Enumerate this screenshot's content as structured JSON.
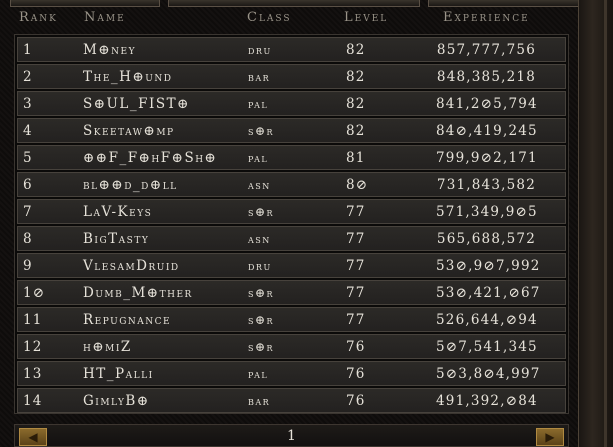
{
  "columns": {
    "rank": "Rank",
    "name": "Name",
    "class": "Class",
    "level": "Level",
    "experience": "Experience"
  },
  "rows": [
    {
      "rank": "1",
      "name": "M⊕ney",
      "class": "dru",
      "level": "82",
      "experience": "857,777,756"
    },
    {
      "rank": "2",
      "name": "The_H⊕und",
      "class": "bar",
      "level": "82",
      "experience": "848,385,218"
    },
    {
      "rank": "3",
      "name": "S⊕UL_FIST⊕",
      "class": "pal",
      "level": "82",
      "experience": "841,2⊘5,794"
    },
    {
      "rank": "4",
      "name": "Skeetaw⊕mp",
      "class": "s⊕r",
      "level": "82",
      "experience": "84⊘,419,245"
    },
    {
      "rank": "5",
      "name": "⊕⊕F_F⊕hF⊕Sh⊕",
      "class": "pal",
      "level": "81",
      "experience": "799,9⊘2,171"
    },
    {
      "rank": "6",
      "name": "bl⊕⊕d_d⊕ll",
      "class": "asn",
      "level": "8⊘",
      "experience": "731,843,582"
    },
    {
      "rank": "7",
      "name": "LaV-Keys",
      "class": "s⊕r",
      "level": "77",
      "experience": "571,349,9⊘5"
    },
    {
      "rank": "8",
      "name": "BigTasty",
      "class": "asn",
      "level": "77",
      "experience": "565,688,572"
    },
    {
      "rank": "9",
      "name": "VlesamDruid",
      "class": "dru",
      "level": "77",
      "experience": "53⊘,9⊘7,992"
    },
    {
      "rank": "1⊘",
      "name": "Dumb_M⊕ther",
      "class": "s⊕r",
      "level": "77",
      "experience": "53⊘,421,⊘67"
    },
    {
      "rank": "11",
      "name": "Repugnance",
      "class": "s⊕r",
      "level": "77",
      "experience": "526,644,⊘94"
    },
    {
      "rank": "12",
      "name": "h⊕miZ",
      "class": "s⊕r",
      "level": "76",
      "experience": "5⊘7,541,345"
    },
    {
      "rank": "13",
      "name": "HT_Palli",
      "class": "pal",
      "level": "76",
      "experience": "5⊘3,8⊘4,997"
    },
    {
      "rank": "14",
      "name": "GimlyB⊕",
      "class": "bar",
      "level": "76",
      "experience": "491,392,⊘84"
    }
  ],
  "pager": {
    "page": "1",
    "prev_icon": "arrow-left-icon",
    "next_icon": "arrow-right-icon"
  },
  "colors": {
    "row_bg": "#2c2a27",
    "text": "#e6e2d9",
    "header_text": "#9a9489",
    "accent_gold": "#8a6a2c"
  }
}
